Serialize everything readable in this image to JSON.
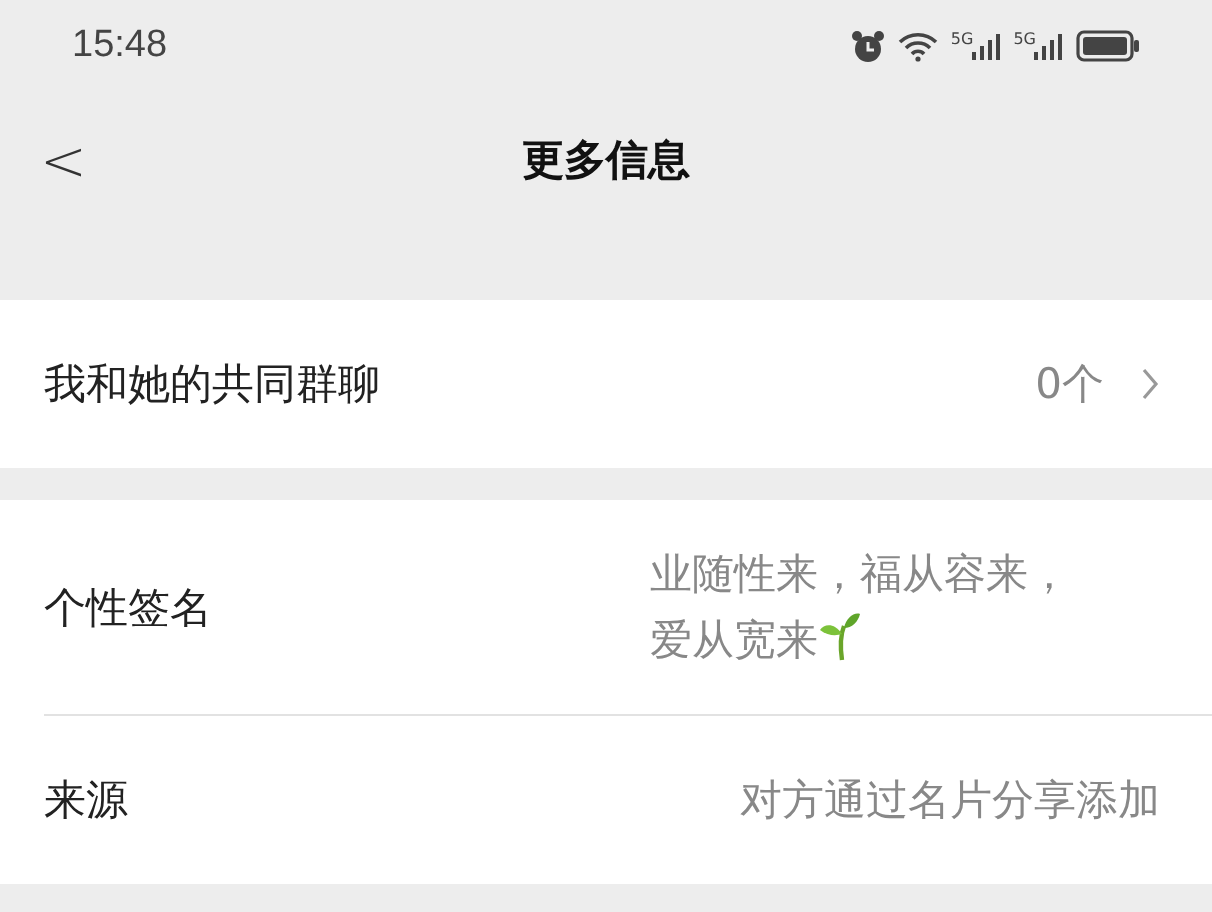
{
  "status_bar": {
    "time": "15:48",
    "network_labels": [
      "5G",
      "5G"
    ]
  },
  "nav": {
    "back": "<",
    "title": "更多信息"
  },
  "sections": [
    {
      "rows": [
        {
          "kind": "link",
          "label": "我和她的共同群聊",
          "value": "0个"
        }
      ]
    },
    {
      "rows": [
        {
          "kind": "signature",
          "label": "个性签名",
          "value_lines": [
            "业随性来，福从容来，",
            "爱从宽来"
          ]
        },
        {
          "kind": "text",
          "label": "来源",
          "value": "对方通过名片分享添加"
        }
      ]
    }
  ]
}
